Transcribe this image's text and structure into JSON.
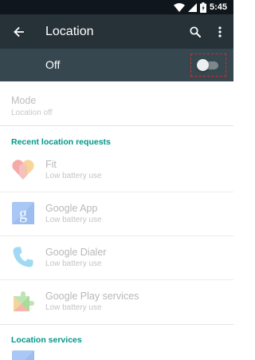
{
  "status_bar": {
    "time": "5:45",
    "icons": [
      "wifi-icon",
      "signal-icon",
      "battery-icon"
    ]
  },
  "toolbar": {
    "title": "Location",
    "back_icon": "arrow-back-icon",
    "search_icon": "search-icon",
    "more_icon": "more-vert-icon"
  },
  "master_switch": {
    "label": "Off",
    "state": "off"
  },
  "mode": {
    "title": "Mode",
    "subtitle": "Location off"
  },
  "recent_requests": {
    "header": "Recent location requests",
    "items": [
      {
        "name": "Fit",
        "subtitle": "Low battery use",
        "icon": "fit-heart-icon"
      },
      {
        "name": "Google App",
        "subtitle": "Low battery use",
        "icon": "google-app-icon"
      },
      {
        "name": "Google Dialer",
        "subtitle": "Low battery use",
        "icon": "phone-dialer-icon"
      },
      {
        "name": "Google Play services",
        "subtitle": "Low battery use",
        "icon": "puzzle-piece-icon"
      }
    ]
  },
  "location_services": {
    "header": "Location services"
  },
  "colors": {
    "status_bar": "#0f171c",
    "toolbar": "#263238",
    "master_bar": "#37474f",
    "accent": "#009688",
    "highlight": "#d32f2f"
  }
}
